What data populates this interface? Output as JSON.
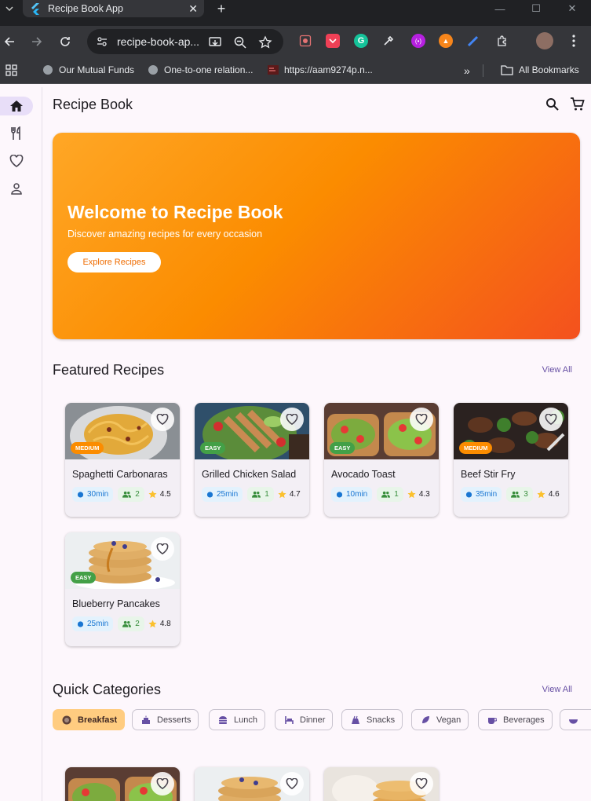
{
  "browser": {
    "tab_title": "Recipe Book App",
    "url": "recipe-book-ap...",
    "bookmarks": [
      "Our Mutual Funds",
      "One-to-one relation...",
      "https://aam9274p.n..."
    ],
    "all_bookmarks": "All Bookmarks"
  },
  "app": {
    "title": "Recipe Book",
    "hero": {
      "title": "Welcome to Recipe Book",
      "subtitle": "Discover amazing recipes for every occasion",
      "button": "Explore Recipes"
    },
    "featured": {
      "title": "Featured Recipes",
      "view_all": "View All",
      "recipes": [
        {
          "name": "Spaghetti Carbonaras",
          "difficulty": "MEDIUM",
          "time": "30min",
          "servings": "2",
          "rating": "4.5"
        },
        {
          "name": "Grilled Chicken Salad",
          "difficulty": "EASY",
          "time": "25min",
          "servings": "1",
          "rating": "4.7"
        },
        {
          "name": "Avocado Toast",
          "difficulty": "EASY",
          "time": "10min",
          "servings": "1",
          "rating": "4.3"
        },
        {
          "name": "Beef Stir Fry",
          "difficulty": "MEDIUM",
          "time": "35min",
          "servings": "3",
          "rating": "4.6"
        },
        {
          "name": "Blueberry Pancakes",
          "difficulty": "EASY",
          "time": "25min",
          "servings": "2",
          "rating": "4.8"
        }
      ]
    },
    "categories": {
      "title": "Quick Categories",
      "view_all": "View All",
      "items": [
        "Breakfast",
        "Desserts",
        "Lunch",
        "Dinner",
        "Snacks",
        "Vegan",
        "Beverages"
      ]
    }
  },
  "colors": {
    "primary": "#6750a4",
    "hero_start": "#ffa726",
    "hero_end": "#f4511e",
    "medium": "#fb8c00",
    "easy": "#43a047",
    "selected_chip": "#ffcc80"
  }
}
